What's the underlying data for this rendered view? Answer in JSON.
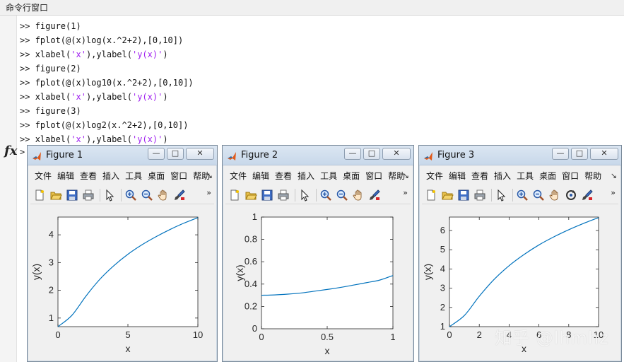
{
  "command_window": {
    "title": "命令行窗口",
    "prompt": ">>",
    "fx_prompt": ">",
    "lines": [
      {
        "code": "figure(1)",
        "strings": []
      },
      {
        "code": "fplot(@(x)log(x.^2+2),[0,10])",
        "strings": []
      },
      {
        "code": "xlabel(",
        "strings": [
          "'x'",
          "),ylabel(",
          "'y(x)'",
          ")"
        ]
      },
      {
        "code": "figure(2)",
        "strings": []
      },
      {
        "code": "fplot(@(x)log10(x.^2+2),[0,10])",
        "strings": []
      },
      {
        "code": "xlabel(",
        "strings": [
          "'x'",
          "),ylabel(",
          "'y(x)'",
          ")"
        ]
      },
      {
        "code": "figure(3)",
        "strings": []
      },
      {
        "code": "fplot(@(x)log2(x.^2+2),[0,10])",
        "strings": []
      },
      {
        "code": "xlabel(",
        "strings": [
          "'x'",
          "),ylabel(",
          "'y(x)'",
          ")"
        ]
      }
    ]
  },
  "figures": [
    {
      "title": "Figure 1",
      "menus": [
        "文件",
        "编辑",
        "查看",
        "插入",
        "工具",
        "桌面",
        "窗口",
        "帮助"
      ],
      "menu_more": "↘",
      "toolbar_more": "»",
      "window_buttons": [
        "—",
        "□",
        "✕"
      ]
    },
    {
      "title": "Figure 2",
      "menus": [
        "文件",
        "编辑",
        "查看",
        "插入",
        "工具",
        "桌面",
        "窗口",
        "帮助"
      ],
      "menu_more": "↘",
      "toolbar_more": "»",
      "window_buttons": [
        "—",
        "□",
        "✕"
      ]
    },
    {
      "title": "Figure 3",
      "menus": [
        "文件",
        "编辑",
        "查看",
        "插入",
        "工具",
        "桌面",
        "窗口",
        "帮助"
      ],
      "menu_more": "↘",
      "toolbar_more": "»",
      "window_buttons": [
        "—",
        "□",
        "✕"
      ]
    }
  ],
  "chart_data": [
    {
      "type": "line",
      "function": "log",
      "xlabel": "x",
      "ylabel": "y(x)",
      "xlim": [
        0,
        10
      ],
      "ylim": [
        0.69,
        4.64
      ],
      "xticks": [
        0,
        5,
        10
      ],
      "yticks": [
        1,
        2,
        3,
        4
      ],
      "line_color": "#0072bd",
      "series": [
        {
          "x": [
            0,
            1,
            2,
            3,
            4,
            5,
            6,
            7,
            8,
            9,
            10
          ],
          "y": [
            0.69,
            1.1,
            1.79,
            2.4,
            2.89,
            3.3,
            3.64,
            3.93,
            4.19,
            4.42,
            4.62
          ]
        }
      ]
    },
    {
      "type": "line",
      "function": "log10",
      "xlabel": "x",
      "ylabel": "y(x)",
      "xlim": [
        0,
        1
      ],
      "ylim": [
        0,
        1
      ],
      "xticks": [
        0,
        0.5,
        1
      ],
      "yticks": [
        0,
        0.2,
        0.4,
        0.6,
        0.8,
        1
      ],
      "line_color": "#0072bd",
      "series": [
        {
          "x": [
            0,
            0.1,
            0.2,
            0.3,
            0.4,
            0.5,
            0.6,
            0.7,
            0.8,
            0.9,
            1
          ],
          "y": [
            0.3,
            0.303,
            0.31,
            0.32,
            0.336,
            0.352,
            0.37,
            0.391,
            0.413,
            0.436,
            0.477
          ]
        }
      ]
    },
    {
      "type": "line",
      "function": "log2",
      "xlabel": "x",
      "ylabel": "y(x)",
      "xlim": [
        0,
        10
      ],
      "ylim": [
        1,
        6.7
      ],
      "xticks": [
        0,
        2,
        4,
        6,
        8,
        10
      ],
      "yticks": [
        1,
        2,
        3,
        4,
        5,
        6
      ],
      "line_color": "#0072bd",
      "series": [
        {
          "x": [
            0,
            1,
            2,
            3,
            4,
            5,
            6,
            7,
            8,
            9,
            10
          ],
          "y": [
            1.0,
            1.58,
            2.58,
            3.46,
            4.17,
            4.75,
            5.25,
            5.67,
            6.04,
            6.37,
            6.67
          ]
        }
      ]
    }
  ],
  "watermark": "知乎 @lhmhz"
}
